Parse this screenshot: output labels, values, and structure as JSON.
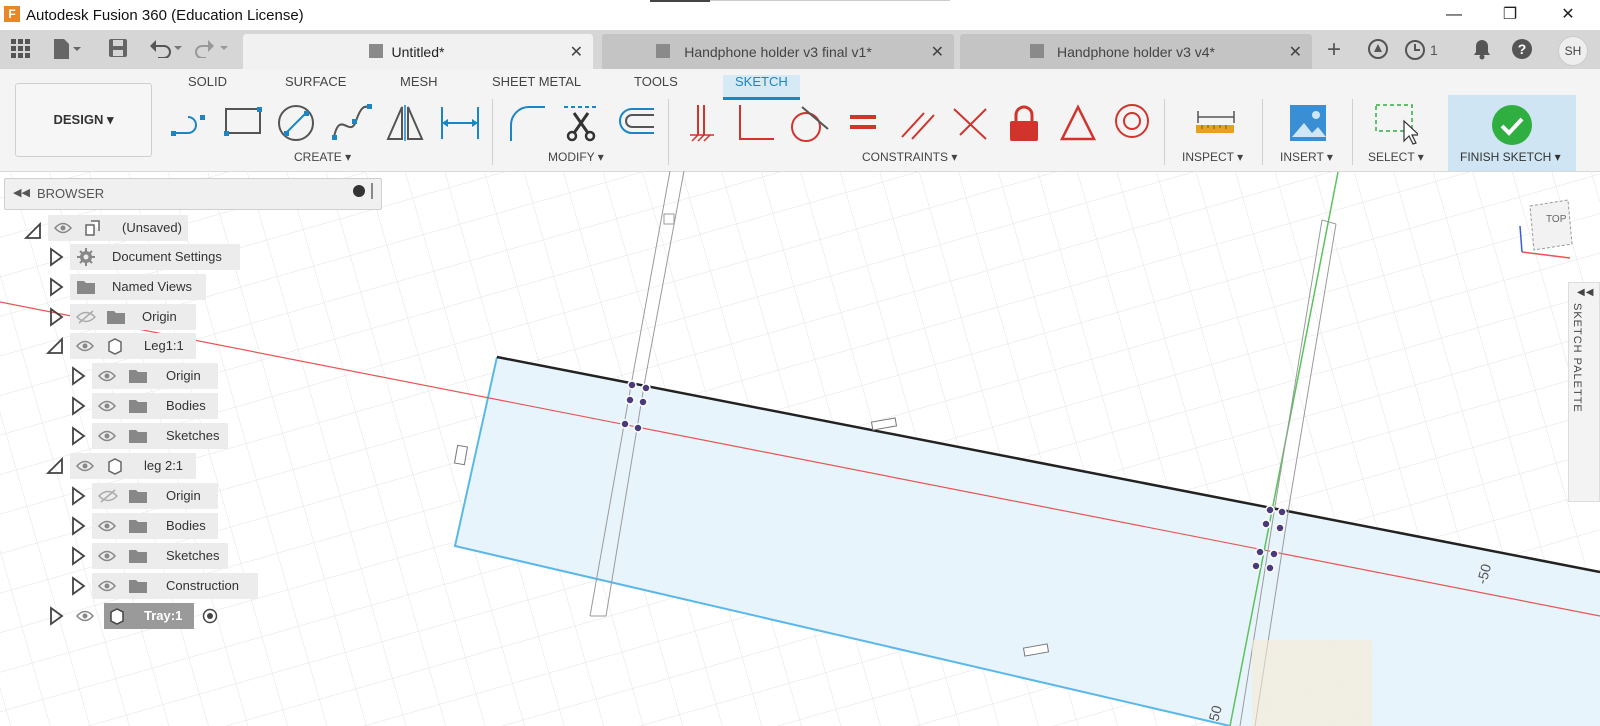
{
  "window": {
    "app_logo": "F",
    "title": "Autodesk Fusion 360 (Education License)",
    "minimize": "—",
    "maximize": "❐",
    "close": "✕"
  },
  "tabbar": {
    "tabs": [
      {
        "label": "Untitled*",
        "active": true
      },
      {
        "label": "Handphone holder v3 final v1*",
        "active": false
      },
      {
        "label": "Handphone holder v3 v4*",
        "active": false
      }
    ],
    "tab_close": "✕",
    "add_tab": "+",
    "jobs_count": "1",
    "help": "?",
    "user_initials": "SH"
  },
  "workspace": {
    "mode": "DESIGN",
    "tabs": [
      "SOLID",
      "SURFACE",
      "MESH",
      "SHEET METAL",
      "TOOLS",
      "SKETCH"
    ],
    "active_tab": "SKETCH"
  },
  "groups": {
    "create": "CREATE",
    "modify": "MODIFY",
    "constraints": "CONSTRAINTS",
    "inspect": "INSPECT",
    "insert": "INSERT",
    "select": "SELECT",
    "finish": "FINISH SKETCH"
  },
  "browser": {
    "title": "BROWSER",
    "items": [
      {
        "label": "(Unsaved)"
      },
      {
        "label": "Document Settings"
      },
      {
        "label": "Named Views"
      },
      {
        "label": "Origin"
      },
      {
        "label": "Leg1:1"
      },
      {
        "label": "Origin"
      },
      {
        "label": "Bodies"
      },
      {
        "label": "Sketches"
      },
      {
        "label": "leg 2:1"
      },
      {
        "label": "Origin"
      },
      {
        "label": "Bodies"
      },
      {
        "label": "Sketches"
      },
      {
        "label": "Construction"
      },
      {
        "label": "Tray:1"
      }
    ]
  },
  "viewport": {
    "viewcube_label": "TOP",
    "dim_right": "-50",
    "dim_bottom": "50"
  },
  "palette": {
    "label": "SKETCH PALETTE"
  },
  "colors": {
    "accent": "#1a86c6",
    "finish_green": "#2faf3f",
    "sketch_fill": "#e6f3fb",
    "axis_red": "#e85555",
    "axis_green": "#5cc25c",
    "constraint_red": "#d0342c"
  }
}
